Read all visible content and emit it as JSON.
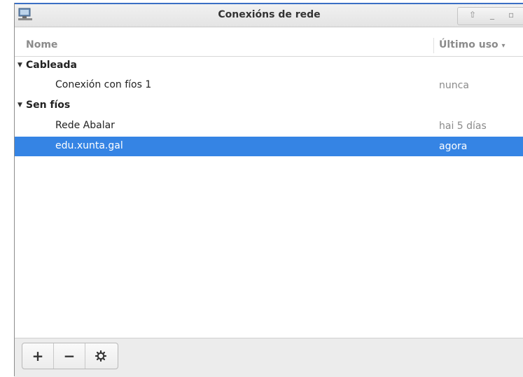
{
  "window": {
    "title": "Conexións de rede"
  },
  "list": {
    "columns": {
      "name": "Nome",
      "last_used": "Último uso"
    },
    "groups": [
      {
        "label": "Cableada",
        "items": [
          {
            "name": "Conexión con fíos 1",
            "last_used": "nunca"
          }
        ]
      },
      {
        "label": "Sen fíos",
        "items": [
          {
            "name": "Rede Abalar",
            "last_used": "hai 5 días"
          },
          {
            "name": "edu.xunta.gal",
            "last_used": "agora",
            "selected": true
          }
        ]
      }
    ]
  },
  "toolbar": {
    "add_label": "+",
    "remove_label": "−"
  },
  "colors": {
    "selection": "#3584e4",
    "titlebar_accent": "#3a6fc4"
  }
}
